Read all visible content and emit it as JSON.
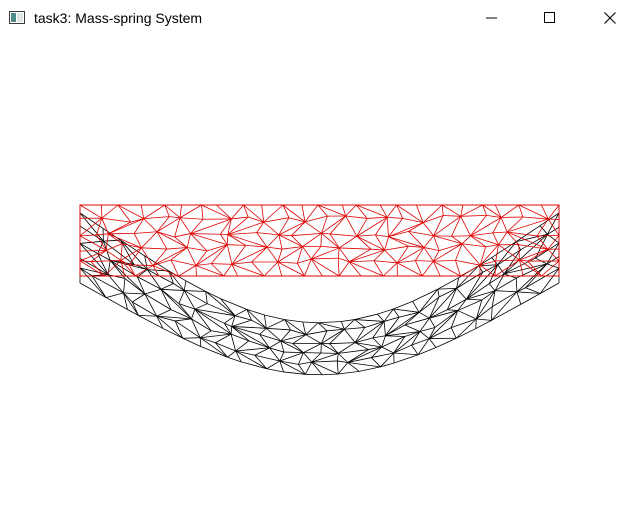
{
  "window": {
    "title": "task3: Mass-spring System",
    "app_icon": "application-window-icon",
    "controls": {
      "minimize_icon": "minimize-icon",
      "maximize_icon": "maximize-icon",
      "close_icon": "close-icon"
    }
  },
  "scene": {
    "rest_mesh_color": "#e00000",
    "deformed_mesh_color": "#000000",
    "background_color": "#ffffff"
  }
}
